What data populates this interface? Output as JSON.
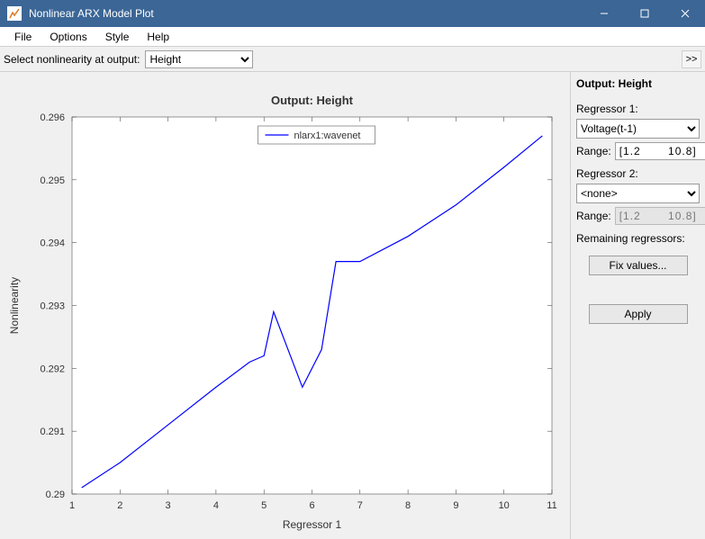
{
  "window": {
    "title": "Nonlinear ARX Model Plot"
  },
  "menu": {
    "file": "File",
    "options": "Options",
    "style": "Style",
    "help": "Help"
  },
  "toolbar": {
    "select_label": "Select nonlinearity at output:",
    "select_value": "Height",
    "expand_btn": ">>"
  },
  "side": {
    "title": "Output: Height",
    "reg1_label": "Regressor 1:",
    "reg1_value": "Voltage(t-1)",
    "reg1_range_label": "Range:",
    "reg1_range_value": "[1.2       10.8]",
    "reg2_label": "Regressor 2:",
    "reg2_value": "<none>",
    "reg2_range_label": "Range:",
    "reg2_range_value": "[1.2       10.8]",
    "remaining_label": "Remaining regressors:",
    "fix_btn": "Fix values...",
    "apply_btn": "Apply"
  },
  "chart_data": {
    "type": "line",
    "title": "Output: Height",
    "xlabel": "Regressor 1",
    "ylabel": "Nonlinearity",
    "xlim": [
      1,
      11
    ],
    "ylim": [
      0.29,
      0.296
    ],
    "xticks": [
      1,
      2,
      3,
      4,
      5,
      6,
      7,
      8,
      9,
      10,
      11
    ],
    "yticks": [
      0.29,
      0.291,
      0.292,
      0.293,
      0.294,
      0.295,
      0.296
    ],
    "series": [
      {
        "name": "nlarx1:wavenet",
        "x": [
          1.2,
          2.0,
          3.0,
          4.0,
          4.7,
          5.0,
          5.2,
          5.8,
          6.2,
          6.5,
          7.0,
          8.0,
          9.0,
          10.0,
          10.8
        ],
        "y": [
          0.2901,
          0.2905,
          0.2911,
          0.2917,
          0.2921,
          0.2922,
          0.2929,
          0.2917,
          0.2923,
          0.2937,
          0.2937,
          0.2941,
          0.2946,
          0.2952,
          0.2957
        ]
      }
    ]
  }
}
